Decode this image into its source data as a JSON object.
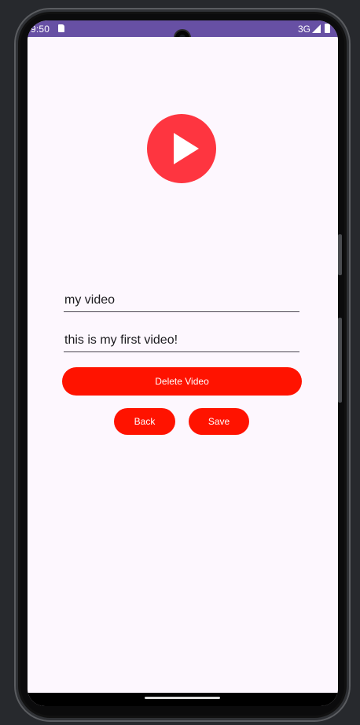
{
  "status_bar": {
    "time": "9:50",
    "network": "3G",
    "icons": [
      "sd-card-icon",
      "signal-icon",
      "battery-icon"
    ]
  },
  "logo": {
    "icon": "play-icon",
    "color": "#fe3540"
  },
  "form": {
    "title_value": "my video",
    "description_value": "this is my first video!"
  },
  "buttons": {
    "delete_label": "Delete Video",
    "back_label": "Back",
    "save_label": "Save"
  },
  "colors": {
    "status_bar": "#6750a4",
    "button": "#ff1300",
    "background": "#fdf7fe"
  }
}
